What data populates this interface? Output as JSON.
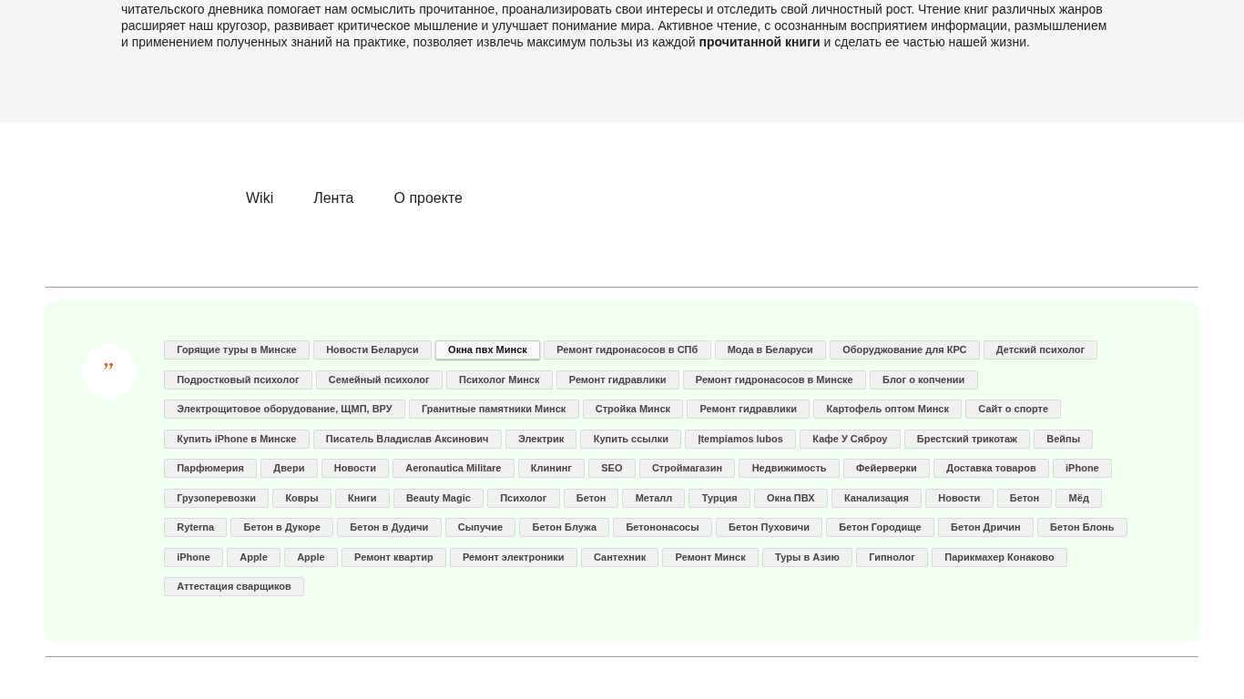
{
  "article": {
    "text": "читательского дневника помогает нам осмыслить прочитанное, проанализировать свои интересы и отследить свой личностный рост. Чтение книг различных жанров расширяет наш кругозор, развивает критическое мышление и улучшает понимание мира. Активное чтение, с осознанным восприятием информации, размышлением и применением полученных знаний на практике, позволяет извлечь максимум пользы из каждой **прочитанной книги** и сделать ее частью нашей жизни."
  },
  "nav": [
    {
      "label": "Wiki"
    },
    {
      "label": "Лента"
    },
    {
      "label": "О проекте"
    }
  ],
  "tags": {
    "items": [
      {
        "label": "Горящие туры в Минске",
        "highlighted": false
      },
      {
        "label": "Новости Беларуси",
        "highlighted": false
      },
      {
        "label": "Окна пвх Минск",
        "highlighted": true
      },
      {
        "label": "Ремонт гидронасосов в СПб",
        "highlighted": false
      },
      {
        "label": "Мода в Беларуси",
        "highlighted": false
      },
      {
        "label": "Оборуджование для КРС",
        "highlighted": false
      },
      {
        "label": "Детский психолог",
        "highlighted": false
      },
      {
        "label": "Подростковый психолог",
        "highlighted": false
      },
      {
        "label": "Семейный психолог",
        "highlighted": false
      },
      {
        "label": "Психолог Минск",
        "highlighted": false
      },
      {
        "label": "Ремонт гидравлики",
        "highlighted": false
      },
      {
        "label": "Ремонт гидронасосов в Минске",
        "highlighted": false
      },
      {
        "label": "Блог о копчении",
        "highlighted": false
      },
      {
        "label": "Электрощитовое оборудование, ЩМП, ВРУ",
        "highlighted": false
      },
      {
        "label": "Гранитные памятники Минск",
        "highlighted": false
      },
      {
        "label": "Стройка Минск",
        "highlighted": false
      },
      {
        "label": "Ремонт гидравлики",
        "highlighted": false
      },
      {
        "label": "Картофель оптом Минск",
        "highlighted": false
      },
      {
        "label": "Сайт о спорте",
        "highlighted": false
      },
      {
        "label": "Купить iPhone в Минске",
        "highlighted": false
      },
      {
        "label": "Писатель Владислав Аксинович",
        "highlighted": false
      },
      {
        "label": "Электрик",
        "highlighted": false
      },
      {
        "label": "Купить ссылки",
        "highlighted": false
      },
      {
        "label": "Įtempiamos lubos",
        "highlighted": false
      },
      {
        "label": "Кафе У Сяброу",
        "highlighted": false
      },
      {
        "label": "Брестский трикотаж",
        "highlighted": false
      },
      {
        "label": "Вейпы",
        "highlighted": false
      },
      {
        "label": "Парфюмерия",
        "highlighted": false
      },
      {
        "label": "Двери",
        "highlighted": false
      },
      {
        "label": "Новости",
        "highlighted": false
      },
      {
        "label": "Aeronautica Militare",
        "highlighted": false
      },
      {
        "label": "Клининг",
        "highlighted": false
      },
      {
        "label": "SEO",
        "highlighted": false
      },
      {
        "label": "Строймагазин",
        "highlighted": false
      },
      {
        "label": "Недвижимость",
        "highlighted": false
      },
      {
        "label": "Фейерверки",
        "highlighted": false
      },
      {
        "label": "Доставка товаров",
        "highlighted": false
      },
      {
        "label": "iPhone",
        "highlighted": false
      },
      {
        "label": "Грузоперевозки",
        "highlighted": false
      },
      {
        "label": "Ковры",
        "highlighted": false
      },
      {
        "label": "Книги",
        "highlighted": false
      },
      {
        "label": "Beauty Magic",
        "highlighted": false
      },
      {
        "label": "Психолог",
        "highlighted": false
      },
      {
        "label": "Бетон",
        "highlighted": false
      },
      {
        "label": "Металл",
        "highlighted": false
      },
      {
        "label": "Турция",
        "highlighted": false
      },
      {
        "label": "Окна ПВХ",
        "highlighted": false
      },
      {
        "label": "Канализация",
        "highlighted": false
      },
      {
        "label": "Новости",
        "highlighted": false
      },
      {
        "label": "Бетон",
        "highlighted": false
      },
      {
        "label": "Мёд",
        "highlighted": false
      },
      {
        "label": "Ryterna",
        "highlighted": false
      },
      {
        "label": "Бетон в Дукоре",
        "highlighted": false
      },
      {
        "label": "Бетон в Дудичи",
        "highlighted": false
      },
      {
        "label": "Сыпучие",
        "highlighted": false
      },
      {
        "label": "Бетон Блужа",
        "highlighted": false
      },
      {
        "label": "Бетононасосы",
        "highlighted": false
      },
      {
        "label": "Бетон Пуховичи",
        "highlighted": false
      },
      {
        "label": "Бетон Городище",
        "highlighted": false
      },
      {
        "label": "Бетон Дричин",
        "highlighted": false
      },
      {
        "label": "Бетон Блонь",
        "highlighted": false
      },
      {
        "label": "iPhone",
        "highlighted": false
      },
      {
        "label": "Apple",
        "highlighted": false
      },
      {
        "label": "Apple",
        "highlighted": false
      },
      {
        "label": "Ремонт квартир",
        "highlighted": false
      },
      {
        "label": "Ремонт электроники",
        "highlighted": false
      },
      {
        "label": "Сантехник",
        "highlighted": false
      },
      {
        "label": "Ремонт Минск",
        "highlighted": false
      },
      {
        "label": "Туры в Азию",
        "highlighted": false
      },
      {
        "label": "Гипнолог",
        "highlighted": false
      },
      {
        "label": "Парикмахер Конаково",
        "highlighted": false
      },
      {
        "label": "Аттестация сварщиков",
        "highlighted": false
      }
    ]
  }
}
